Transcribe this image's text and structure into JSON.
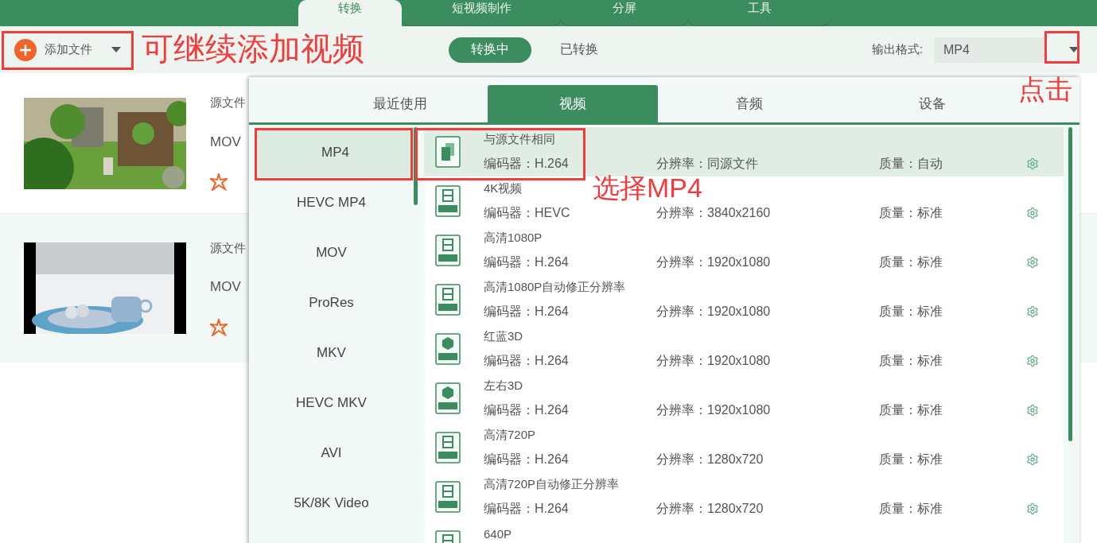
{
  "top_tabs": [
    {
      "label": "转换",
      "selected": true
    },
    {
      "label": "短视频制作",
      "selected": false
    },
    {
      "label": "分屏",
      "selected": false
    },
    {
      "label": "工具",
      "selected": false
    }
  ],
  "toolbar": {
    "add_button": "添加文件",
    "status_tabs": [
      {
        "label": "转换中",
        "selected": true
      },
      {
        "label": "已转换",
        "selected": false
      }
    ],
    "output_format_label": "输出格式:",
    "output_format_value": "MP4"
  },
  "files": [
    {
      "source_label": "源文件",
      "format": "MOV"
    },
    {
      "source_label": "源文件",
      "format": "MOV"
    }
  ],
  "format_panel": {
    "tabs": [
      {
        "label": "最近使用",
        "selected": false
      },
      {
        "label": "视频",
        "selected": true
      },
      {
        "label": "音频",
        "selected": false
      },
      {
        "label": "设备",
        "selected": false
      }
    ],
    "categories": [
      {
        "label": "MP4",
        "selected": true
      },
      {
        "label": "HEVC MP4",
        "selected": false
      },
      {
        "label": "MOV",
        "selected": false
      },
      {
        "label": "ProRes",
        "selected": false
      },
      {
        "label": "MKV",
        "selected": false
      },
      {
        "label": "HEVC MKV",
        "selected": false
      },
      {
        "label": "AVI",
        "selected": false
      },
      {
        "label": "5K/8K Video",
        "selected": false
      }
    ],
    "presets": [
      {
        "kind": "copy",
        "name": "与源文件相同",
        "encoder": "编码器：H.264",
        "resolution": "分辨率：同源文件",
        "quality": "质量：自动",
        "selected": true
      },
      {
        "kind": "film",
        "name": "4K视频",
        "encoder": "编码器：HEVC",
        "resolution": "分辨率：3840x2160",
        "quality": "质量：标准",
        "selected": false
      },
      {
        "kind": "film",
        "name": "高清1080P",
        "encoder": "编码器：H.264",
        "resolution": "分辨率：1920x1080",
        "quality": "质量：标准",
        "selected": false
      },
      {
        "kind": "film",
        "name": "高清1080P自动修正分辨率",
        "encoder": "编码器：H.264",
        "resolution": "分辨率：1920x1080",
        "quality": "质量：标准",
        "selected": false
      },
      {
        "kind": "cube",
        "name": "红蓝3D",
        "encoder": "编码器：H.264",
        "resolution": "分辨率：1920x1080",
        "quality": "质量：标准",
        "selected": false
      },
      {
        "kind": "cube",
        "name": "左右3D",
        "encoder": "编码器：H.264",
        "resolution": "分辨率：1920x1080",
        "quality": "质量：标准",
        "selected": false
      },
      {
        "kind": "film",
        "name": "高清720P",
        "encoder": "编码器：H.264",
        "resolution": "分辨率：1280x720",
        "quality": "质量：标准",
        "selected": false
      },
      {
        "kind": "film",
        "name": "高清720P自动修正分辨率",
        "encoder": "编码器：H.264",
        "resolution": "分辨率：1280x720",
        "quality": "质量：标准",
        "selected": false
      },
      {
        "kind": "film",
        "name": "640P",
        "selected": false
      }
    ]
  },
  "annotations": {
    "add_hint": "可继续添加视频",
    "click_hint": "点击",
    "select_hint": "选择MP4"
  }
}
